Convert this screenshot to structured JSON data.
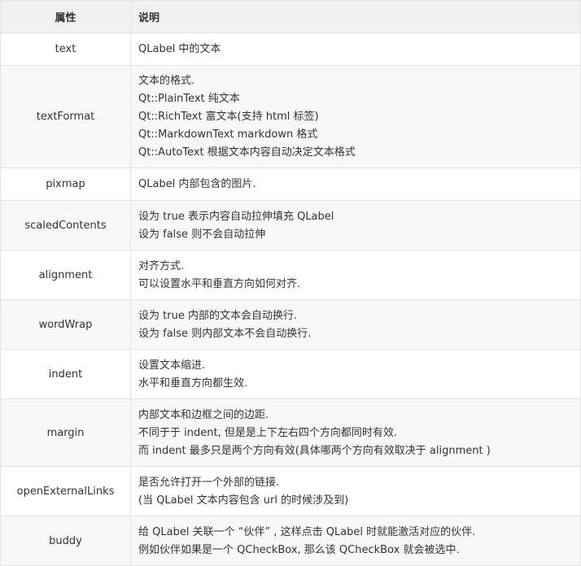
{
  "headers": {
    "name": "属性",
    "desc": "说明"
  },
  "rows": [
    {
      "name": "text",
      "lines": [
        "QLabel 中的文本"
      ]
    },
    {
      "name": "textFormat",
      "lines": [
        "文本的格式.",
        "Qt::PlainText 纯文本",
        "Qt::RichText 富文本(支持 html 标签)",
        "Qt::MarkdownText markdown 格式",
        "Qt::AutoText 根据文本内容自动决定文本格式"
      ]
    },
    {
      "name": "pixmap",
      "lines": [
        "QLabel 内部包含的图片."
      ]
    },
    {
      "name": "scaledContents",
      "lines": [
        "设为 true 表示内容自动拉伸填充 QLabel",
        "设为 false 则不会自动拉伸"
      ]
    },
    {
      "name": "alignment",
      "lines": [
        "对齐方式.",
        "可以设置水平和垂直方向如何对齐."
      ]
    },
    {
      "name": "wordWrap",
      "lines": [
        "设为 true 内部的文本会自动换行.",
        "设为 false 则内部文本不会自动换行."
      ]
    },
    {
      "name": "indent",
      "lines": [
        "设置文本缩进.",
        "水平和垂直方向都生效."
      ]
    },
    {
      "name": "margin",
      "lines": [
        "内部文本和边框之间的边距.",
        "不同于于 indent, 但是是上下左右四个方向都同时有效.",
        "而 indent 最多只是两个方向有效(具体哪两个方向有效取决于 alignment )"
      ]
    },
    {
      "name": "openExternalLinks",
      "lines": [
        "是否允许打开一个外部的链接.",
        "(当 QLabel 文本内容包含 url 的时候涉及到)"
      ]
    },
    {
      "name": "buddy",
      "lines": [
        "给 QLabel 关联一个 “伙伴” , 这样点击 QLabel 时就能激活对应的伙伴.",
        "例如伙伴如果是一个 QCheckBox, 那么该 QCheckBox 就会被选中."
      ]
    }
  ]
}
